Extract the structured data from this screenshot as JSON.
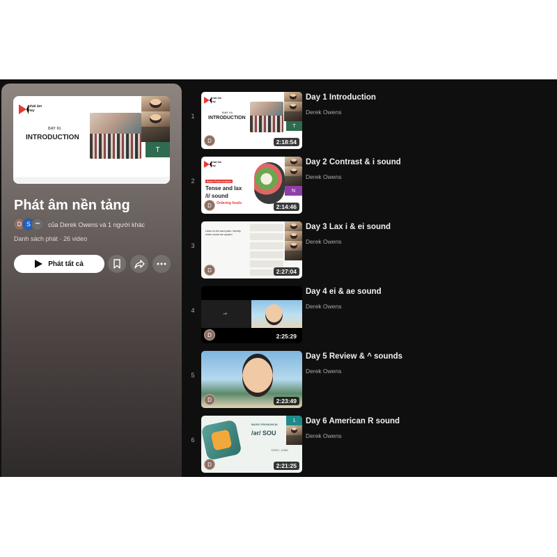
{
  "playlist": {
    "hero": {
      "logo_line1": "phát âm",
      "logo_line2": "hay",
      "day_label": "DAY 01",
      "slide_title": "INTRODUCTION",
      "tile_letter": "T"
    },
    "title": "Phát âm nền tảng",
    "avatars": [
      "D",
      "S",
      "•••"
    ],
    "owner_line": "của Derek Owens và 1 người khác",
    "meta": "Danh sách phát · 26 video",
    "play_all_label": "Phát tất cả"
  },
  "videos": [
    {
      "index": "1",
      "title": "Day 1 Introduction",
      "channel": "Derek Owens",
      "duration": "2:18:54",
      "avatar": "D",
      "thumb": {
        "logo_line1": "phát âm",
        "logo_line2": "hay",
        "day_label": "DAY 01",
        "slide_title": "INTRODUCTION",
        "tile_letter": "T"
      }
    },
    {
      "index": "2",
      "title": "Day 2 Contrast & i sound",
      "channel": "Derek Owens",
      "duration": "2:14:46",
      "avatar": "D",
      "thumb": {
        "logo_line1": "phát âm",
        "logo_line2": "hay",
        "badge": "Basic Pronunciation",
        "slide_title_1": "Tense and lax",
        "slide_title_2": "/i/ sound",
        "sub": "Ordering foods",
        "tile_letter": "N"
      }
    },
    {
      "index": "3",
      "title": "Day 3 Lax i & ei sound",
      "channel": "Derek Owens",
      "duration": "2:27:04",
      "avatar": "D",
      "thumb": {
        "instruction_1": "Listen to the word pairs. Identify",
        "instruction_2": "which words are spoken."
      }
    },
    {
      "index": "4",
      "title": "Day 4 ei & ae sound",
      "channel": "Derek Owens",
      "duration": "2:25:29",
      "avatar": "D",
      "thumb": {
        "label": "HP"
      }
    },
    {
      "index": "5",
      "title": "Day 5 Review & ^ sounds",
      "channel": "Derek Owens",
      "duration": "2:23:49",
      "avatar": "D",
      "thumb": {}
    },
    {
      "index": "6",
      "title": "Day 6 American R sound",
      "channel": "Derek Owens",
      "duration": "2:21:25",
      "avatar": "D",
      "thumb": {
        "badge": "BASIC PRONUNCIA",
        "slide_title": "/ər/ SOU",
        "sub": "TOPIC: JOBS",
        "tile_letter": "1"
      }
    }
  ],
  "colors": {
    "background": "#0f0f0f",
    "accent_red": "#e53935",
    "text_primary": "#f1f1f1",
    "text_secondary": "#aaaaaa",
    "tile_green": "#2e6b4f",
    "tile_purple": "#8e3fa6",
    "tile_teal": "#1f8a8a"
  },
  "icons": {
    "play": "play-icon",
    "save": "bookmark-icon",
    "share": "share-icon",
    "more": "more-horizontal-icon"
  }
}
